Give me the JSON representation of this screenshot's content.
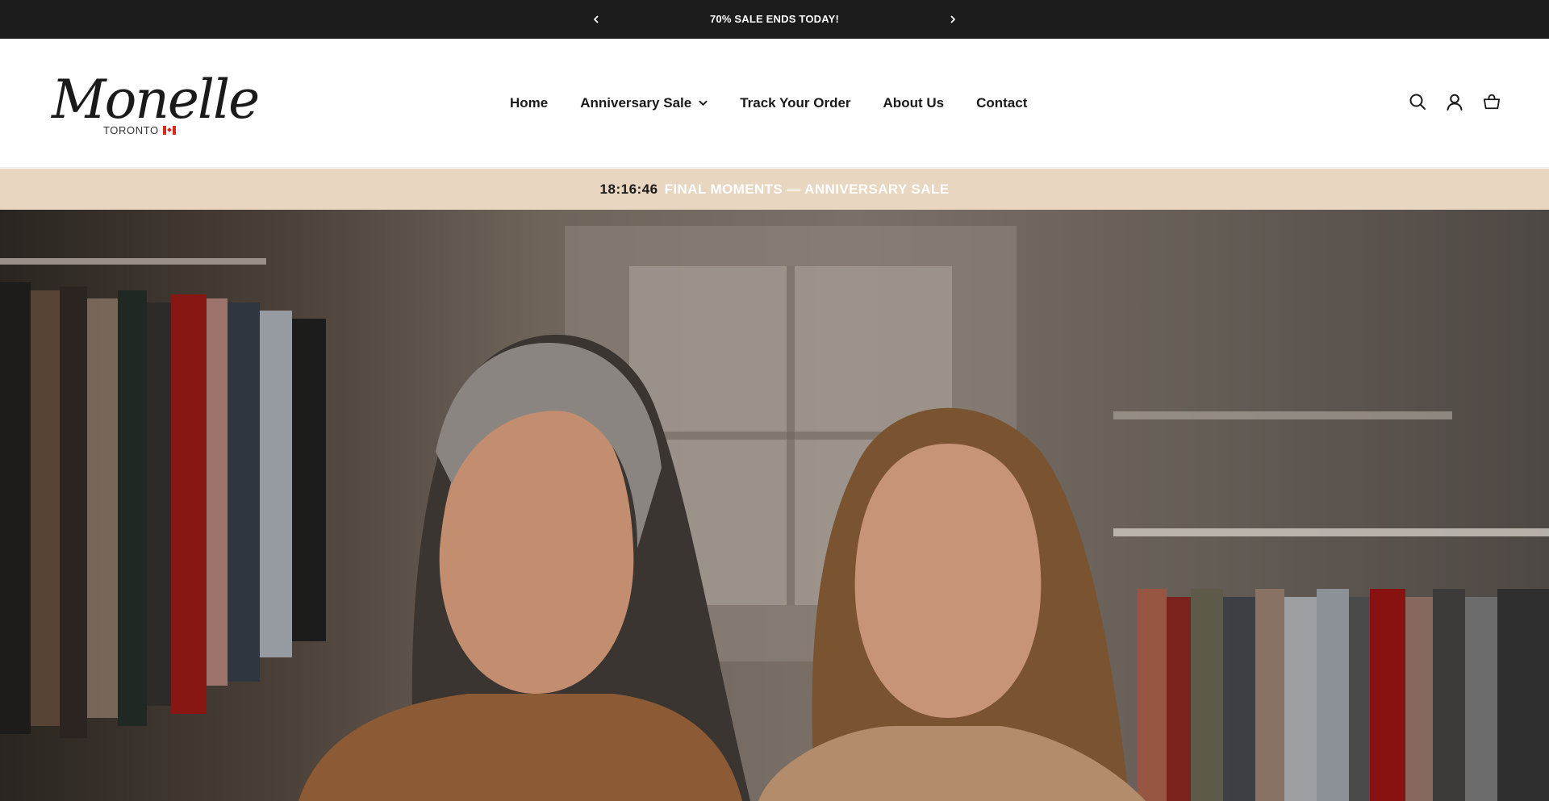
{
  "announcement": {
    "message": "70% SALE ENDS TODAY!",
    "prev_icon": "chevron-left-icon",
    "next_icon": "chevron-right-icon"
  },
  "header": {
    "logo": {
      "script": "Monelle",
      "subtitle": "TORONTO",
      "flag": "canada-flag"
    },
    "nav": [
      {
        "label": "Home"
      },
      {
        "label": "Anniversary Sale",
        "has_dropdown": true
      },
      {
        "label": "Track Your Order"
      },
      {
        "label": "About Us"
      },
      {
        "label": "Contact"
      }
    ],
    "icons": [
      "search-icon",
      "account-icon",
      "cart-icon"
    ]
  },
  "countdown": {
    "timer": "18:16:46",
    "text": "FINAL MOMENTS — ANNIVERSARY SALE"
  },
  "colors": {
    "announcement_bg": "#1c1c1c",
    "countdown_bg": "#e8d6c1",
    "text_dark": "#1a1a1a"
  },
  "hero": {
    "image": "two-women-in-clothing-boutique"
  }
}
